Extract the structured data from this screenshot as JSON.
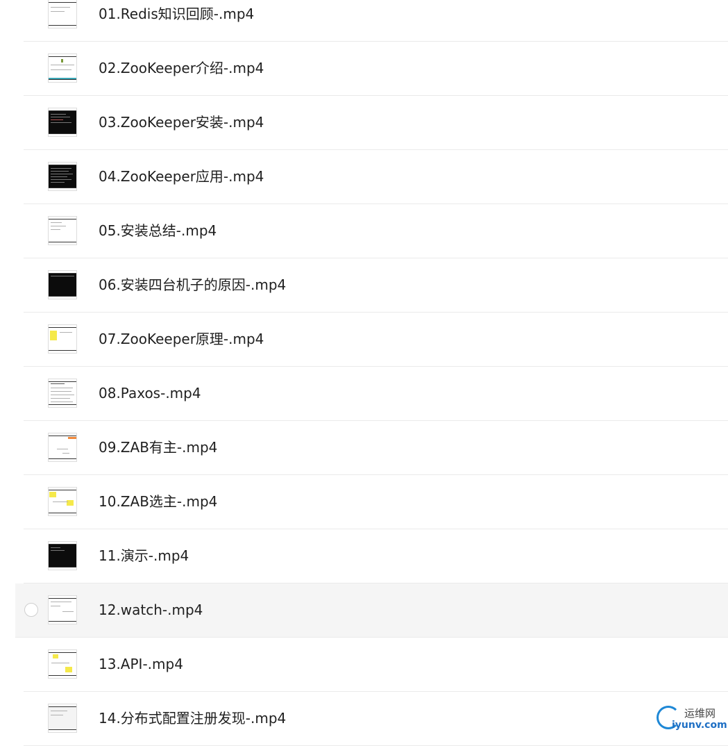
{
  "files": [
    {
      "name": "01.Redis知识回顾-.mp4",
      "thumb": "light"
    },
    {
      "name": "02.ZooKeeper介绍-.mp4",
      "thumb": "light"
    },
    {
      "name": "03.ZooKeeper安装-.mp4",
      "thumb": "dark"
    },
    {
      "name": "04.ZooKeeper应用-.mp4",
      "thumb": "dark"
    },
    {
      "name": "05.安装总结-.mp4",
      "thumb": "light"
    },
    {
      "name": "06.安装四台机子的原因-.mp4",
      "thumb": "dark"
    },
    {
      "name": "07.ZooKeeper原理-.mp4",
      "thumb": "light"
    },
    {
      "name": "08.Paxos-.mp4",
      "thumb": "light"
    },
    {
      "name": "09.ZAB有主-.mp4",
      "thumb": "light"
    },
    {
      "name": "10.ZAB选主-.mp4",
      "thumb": "light"
    },
    {
      "name": "11.演示-.mp4",
      "thumb": "dark"
    },
    {
      "name": "12.watch-.mp4",
      "thumb": "light"
    },
    {
      "name": "13.API-.mp4",
      "thumb": "light"
    },
    {
      "name": "14.分布式配置注册发现-.mp4",
      "thumb": "grey"
    }
  ],
  "watermark": {
    "cn": "运维网",
    "en": "iyunv.com"
  }
}
